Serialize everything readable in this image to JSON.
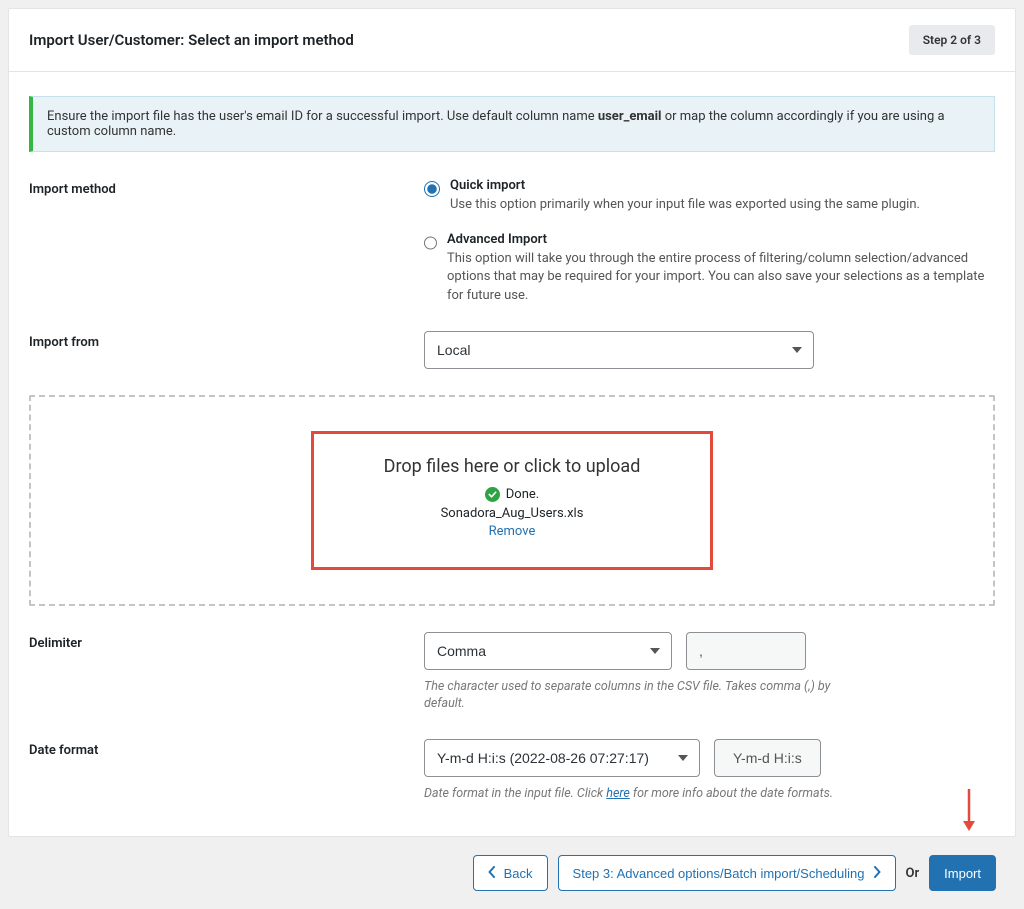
{
  "header": {
    "title": "Import User/Customer: Select an import method",
    "step_badge": "Step 2 of 3"
  },
  "notice": {
    "prefix": "Ensure the import file has the user's email ID for a successful import. Use default column name ",
    "bold": "user_email",
    "suffix": " or map the column accordingly if you are using a custom column name."
  },
  "import_method": {
    "label": "Import method",
    "options": [
      {
        "title": "Quick import",
        "desc": "Use this option primarily when your input file was exported using the same plugin.",
        "checked": true
      },
      {
        "title": "Advanced Import",
        "desc": "This option will take you through the entire process of filtering/column selection/advanced options that may be required for your import. You can also save your selections as a template for future use.",
        "checked": false
      }
    ]
  },
  "import_from": {
    "label": "Import from",
    "selected": "Local"
  },
  "dropzone": {
    "title": "Drop files here or click to upload",
    "done": "Done.",
    "filename": "Sonadora_Aug_Users.xls",
    "remove": "Remove"
  },
  "delimiter": {
    "label": "Delimiter",
    "selected": "Comma",
    "char": ",",
    "helper": "The character used to separate columns in the CSV file. Takes comma (,) by default."
  },
  "date_format": {
    "label": "Date format",
    "selected": "Y-m-d H:i:s (2022-08-26 07:27:17)",
    "button": "Y-m-d H:i:s",
    "helper_prefix": "Date format in the input file. Click ",
    "helper_link": "here",
    "helper_suffix": " for more info about the date formats."
  },
  "footer": {
    "back": "Back",
    "step3": "Step 3: Advanced options/Batch import/Scheduling",
    "or": "Or",
    "import": "Import"
  }
}
